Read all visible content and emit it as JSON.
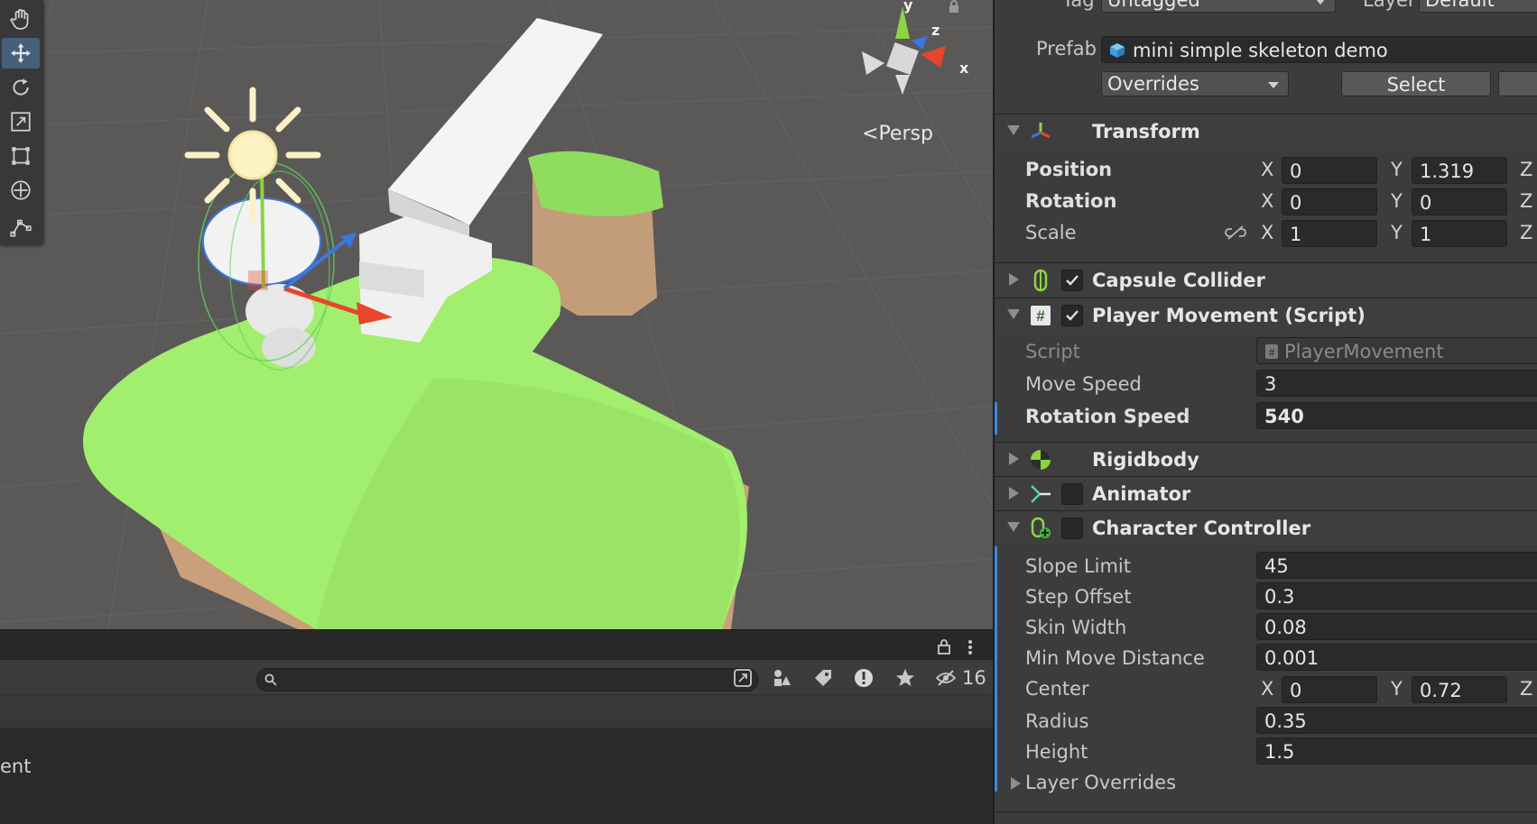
{
  "scene": {
    "persp_label": "Persp",
    "gizmo_axes": {
      "y": "y",
      "z": "z",
      "x": "x"
    },
    "tools": [
      "hand-tool",
      "move-tool",
      "rotate-tool",
      "scale-tool",
      "rect-tool",
      "transform-tool",
      "custom-tool"
    ],
    "active_tool": "move-tool"
  },
  "bottom_panel": {
    "search_placeholder": "",
    "hidden_count": "16",
    "list_item_fragment": "ent"
  },
  "inspector": {
    "tag_label": "Tag",
    "tag_value": "Untagged",
    "layer_label": "Layer",
    "layer_value": "Default",
    "prefab_label": "Prefab",
    "prefab_name": "mini simple skeleton demo",
    "overrides_label": "Overrides",
    "select_label": "Select",
    "transform": {
      "title": "Transform",
      "position_label": "Position",
      "rotation_label": "Rotation",
      "scale_label": "Scale",
      "x_label": "X",
      "y_label": "Y",
      "z_label": "Z",
      "position": {
        "x": "0",
        "y": "1.319"
      },
      "rotation": {
        "x": "0",
        "y": "0"
      },
      "scale": {
        "x": "1",
        "y": "1"
      }
    },
    "capsule_collider": {
      "title": "Capsule Collider",
      "enabled": true
    },
    "player_movement": {
      "title": "Player Movement (Script)",
      "enabled": true,
      "script_label": "Script",
      "script_value": "PlayerMovement",
      "move_speed_label": "Move Speed",
      "move_speed": "3",
      "rotation_speed_label": "Rotation Speed",
      "rotation_speed": "540"
    },
    "rigidbody": {
      "title": "Rigidbody"
    },
    "animator": {
      "title": "Animator",
      "enabled": false
    },
    "character_controller": {
      "title": "Character Controller",
      "enabled": false,
      "slope_limit_label": "Slope Limit",
      "slope_limit": "45",
      "step_offset_label": "Step Offset",
      "step_offset": "0.3",
      "skin_width_label": "Skin Width",
      "skin_width": "0.08",
      "min_move_label": "Min Move Distance",
      "min_move": "0.001",
      "center_label": "Center",
      "center": {
        "x": "0",
        "y": "0.72"
      },
      "radius_label": "Radius",
      "radius": "0.35",
      "height_label": "Height",
      "height": "1.5",
      "layer_overrides_label": "Layer Overrides"
    }
  },
  "colors": {
    "scene_bg": "#5b5858",
    "grass": "#9be868",
    "dirt": "#c9a27e",
    "accent_blue": "#46607c",
    "x_axis": "#e8452c",
    "y_axis": "#8cd444",
    "z_axis": "#3a78e0"
  }
}
